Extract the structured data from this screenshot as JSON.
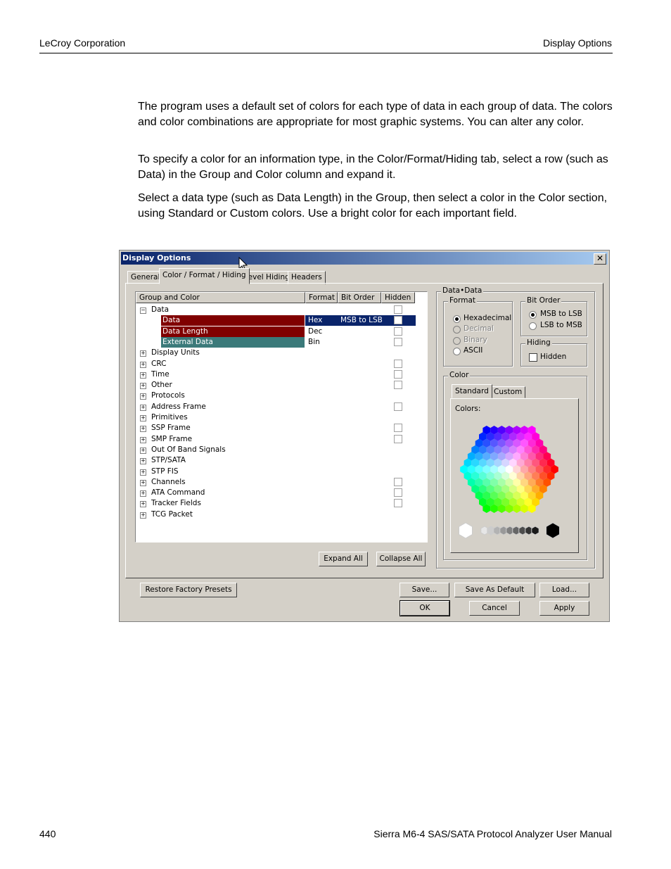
{
  "header": {
    "left": "LeCroy Corporation",
    "right": "Display Options"
  },
  "body": {
    "para1": "The program uses a default set of colors for each type of data in each group of data. The colors and color combinations are appropriate for most graphic systems. You can alter any color.",
    "para2": "To specify a color for an information type, in the Color/Format/Hiding tab, select a row (such as Data) in the Group and Color column and expand it.",
    "para3": "Select a data type (such as Data Length) in the Group, then select a color in the Color section, using Standard or Custom colors. Use a bright color for each important field."
  },
  "dialog": {
    "title": "Display Options",
    "close": "✕",
    "tabs": [
      "General",
      "Color / Format / Hiding",
      "Level Hiding",
      "Headers"
    ],
    "columns": [
      "Group and Color",
      "Format",
      "Bit Order",
      "Hidden"
    ],
    "tree": [
      {
        "label": "Data",
        "expand": "⊟"
      },
      {
        "label": "Data",
        "format": "Hex",
        "bitorder": "MSB to LSB"
      },
      {
        "label": "Data Length",
        "format": "Dec"
      },
      {
        "label": "External Data",
        "format": "Bin"
      },
      {
        "label": "Display Units",
        "expand": "⊞"
      },
      {
        "label": "CRC",
        "expand": "⊞"
      },
      {
        "label": "Time",
        "expand": "⊞"
      },
      {
        "label": "Other",
        "expand": "⊞"
      },
      {
        "label": "Protocols",
        "expand": "⊞"
      },
      {
        "label": "Address Frame",
        "expand": "⊞"
      },
      {
        "label": "Primitives",
        "expand": "⊞"
      },
      {
        "label": "SSP Frame",
        "expand": "⊞"
      },
      {
        "label": "SMP Frame",
        "expand": "⊞"
      },
      {
        "label": "Out Of Band Signals",
        "expand": "⊞"
      },
      {
        "label": "STP/SATA",
        "expand": "⊞"
      },
      {
        "label": "STP FIS",
        "expand": "⊞"
      },
      {
        "label": "Channels",
        "expand": "⊞"
      },
      {
        "label": "ATA Command",
        "expand": "⊞"
      },
      {
        "label": "Tracker Fields",
        "expand": "⊞"
      },
      {
        "label": "TCG Packet",
        "expand": "⊞"
      }
    ],
    "expand_all": "Expand All",
    "collapse_all": "Collapse All",
    "right_group": "Data•Data",
    "format_group": "Format",
    "format_options": [
      "Hexadecimal",
      "Decimal",
      "Binary",
      "ASCII"
    ],
    "bitorder_group": "Bit Order",
    "bitorder_options": [
      "MSB to LSB",
      "LSB to MSB"
    ],
    "hiding_group": "Hiding",
    "hidden_label": "Hidden",
    "color_group": "Color",
    "color_tabs": [
      "Standard",
      "Custom"
    ],
    "colors_label": "Colors:",
    "buttons": {
      "restore": "Restore Factory Presets",
      "save": "Save...",
      "save_default": "Save As Default",
      "load": "Load...",
      "ok": "OK",
      "cancel": "Cancel",
      "apply": "Apply"
    },
    "colors": {
      "selected_row": "#800000",
      "external_row": "#3b7a7a",
      "highlight": "#0a246a"
    }
  },
  "footer": {
    "page": "440",
    "title": "Sierra M6-4 SAS/SATA Protocol Analyzer User Manual"
  }
}
